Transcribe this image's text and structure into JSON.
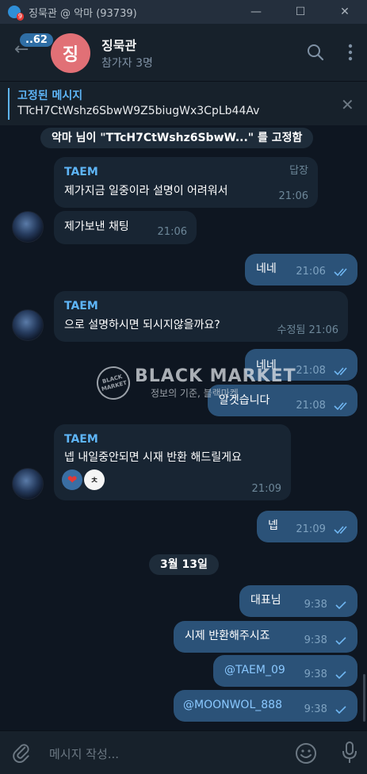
{
  "window": {
    "title": "징묵관 @ 악마 (93739)",
    "badge": "9",
    "controls": {
      "minimize": "—",
      "maximize": "☐",
      "close": "✕"
    }
  },
  "header": {
    "unread": "..62",
    "avatar_letter": "징",
    "title": "징묵관",
    "subtitle": "참가자 3명",
    "avatar_color": "#e17076"
  },
  "pinned": {
    "title": "고정된 메시지",
    "text": "TTcH7CtWshz6SbwW9Z5biugWx3CpLb44Av"
  },
  "service_pin": "악마 님이 \"TTcH7CtWshz6SbwW...\" 를 고정함",
  "date_divider": "3월 13일",
  "messages": [
    {
      "sender": "TAEM",
      "reply_label": "답장",
      "text": "제가지금 일중이라 설명이 어려워서",
      "time": "21:06"
    },
    {
      "text": "제가보낸 채팅",
      "time": "21:06"
    },
    {
      "text": "네네",
      "time": "21:06"
    },
    {
      "sender": "TAEM",
      "text": "으로 설명하시면 되시지않을까요?",
      "time": "수정됨 21:06"
    },
    {
      "text": "네네",
      "time": "21:08"
    },
    {
      "text": "알겟습니다",
      "time": "21:08"
    },
    {
      "sender": "TAEM",
      "text": "넵 내일중안되면 시재 반환 해드릴게요",
      "time": "21:09",
      "reactions": {
        "emoji": "❤",
        "user_initial": "ㅊ"
      }
    },
    {
      "text": "넵",
      "time": "21:09"
    },
    {
      "text": "대표님",
      "time": "9:38"
    },
    {
      "text": "시제 반환해주시죠",
      "time": "9:38"
    },
    {
      "text": "@TAEM_09",
      "time": "9:38"
    },
    {
      "text": "@MOONWOL_888",
      "time": "9:38"
    }
  ],
  "watermark": {
    "badge": "BLACK MARKET",
    "main": "BLACK MARKET",
    "sub": "정보의 기준, 블랙마켓"
  },
  "input": {
    "placeholder": "메시지 작성..."
  },
  "colors": {
    "background": "#0e1621",
    "incoming": "#182533",
    "outgoing": "#2b5278",
    "accent": "#5eb5f7"
  },
  "icons": [
    "back-arrow-icon",
    "search-icon",
    "more-vertical-icon",
    "close-icon",
    "double-check-icon",
    "single-check-icon",
    "attach-icon",
    "emoji-icon",
    "mic-icon"
  ]
}
